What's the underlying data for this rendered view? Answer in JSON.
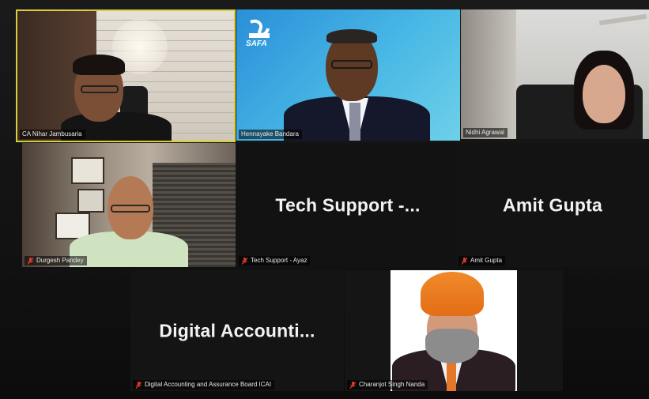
{
  "participants": [
    {
      "name": "CA Nihar Jambusaria",
      "muted": false,
      "video": true,
      "active_speaker": true
    },
    {
      "name": "Hennayake Bandara",
      "muted": false,
      "video": true
    },
    {
      "name": "Nidhi Agrawal",
      "muted": false,
      "video": true
    },
    {
      "name": "Durgesh Pandey",
      "muted": true,
      "video": true
    },
    {
      "name": "Tech Support - Ayaz",
      "display": "Tech Support -...",
      "muted": true,
      "video": false
    },
    {
      "name": "Amit Gupta",
      "display": "Amit Gupta",
      "muted": true,
      "video": false
    },
    {
      "name": "Digital Accounting and Assurance Board ICAI",
      "display": "Digital Accounti...",
      "muted": true,
      "video": false
    },
    {
      "name": "Charanjot Singh Nanda",
      "muted": true,
      "video": true
    }
  ],
  "logo_text": "SAFA",
  "icons": {
    "mute": "microphone-muted-icon"
  },
  "colors": {
    "active_border": "#d8cf3a",
    "mute_red": "#e23b2e"
  }
}
